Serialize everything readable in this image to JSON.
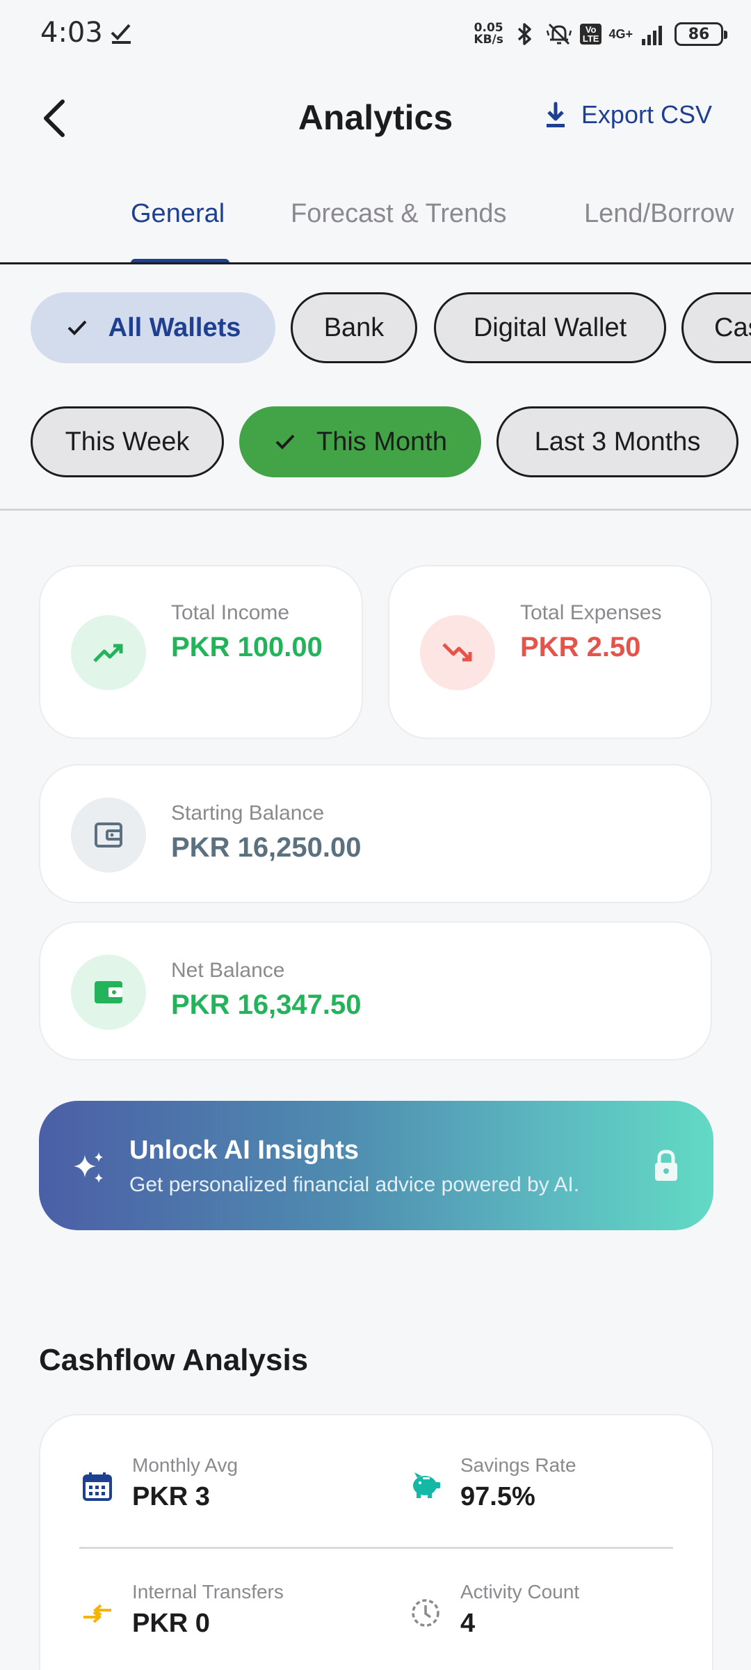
{
  "status_bar": {
    "time": "4:03",
    "net_speed_value": "0.05",
    "net_speed_unit": "KB/s",
    "volte_label_top": "Vo",
    "volte_label_bottom": "LTE",
    "network_type": "4G+",
    "battery_level": "86"
  },
  "header": {
    "title": "Analytics",
    "export_label": "Export CSV"
  },
  "tabs": [
    {
      "label": "General",
      "active": true
    },
    {
      "label": "Forecast & Trends",
      "active": false
    },
    {
      "label": "Lend/Borrow",
      "active": false
    }
  ],
  "wallet_filters": [
    {
      "label": "All Wallets",
      "selected": true
    },
    {
      "label": "Bank",
      "selected": false
    },
    {
      "label": "Digital Wallet",
      "selected": false
    },
    {
      "label": "Cas",
      "selected": false
    }
  ],
  "period_filters": [
    {
      "label": "This Week",
      "selected": false
    },
    {
      "label": "This Month",
      "selected": true
    },
    {
      "label": "Last 3 Months",
      "selected": false
    }
  ],
  "summary": {
    "income": {
      "label": "Total Income",
      "value": "PKR 100.00",
      "color": "#22b35b"
    },
    "expenses": {
      "label": "Total Expenses",
      "value": "PKR 2.50",
      "color": "#e5534b"
    },
    "starting_balance": {
      "label": "Starting Balance",
      "value": "PKR 16,250.00",
      "color": "#5b717f"
    },
    "net_balance": {
      "label": "Net Balance",
      "value": "PKR 16,347.50",
      "color": "#22b35b"
    }
  },
  "ai_banner": {
    "title": "Unlock AI Insights",
    "subtitle": "Get personalized financial advice powered by AI."
  },
  "cashflow": {
    "title": "Cashflow Analysis",
    "monthly_avg": {
      "label": "Monthly Avg",
      "value": "PKR 3"
    },
    "savings_rate": {
      "label": "Savings Rate",
      "value": "97.5%"
    },
    "internal_transfers": {
      "label": "Internal Transfers",
      "value": "PKR 0"
    },
    "activity_count": {
      "label": "Activity Count",
      "value": "4"
    }
  },
  "colors": {
    "accent": "#1f3f91",
    "selected_green": "#43a447",
    "selected_blue_bg": "#d3dcec"
  }
}
